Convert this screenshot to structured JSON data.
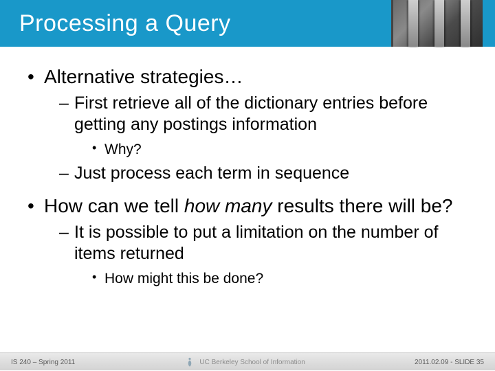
{
  "title": "Processing a Query",
  "bullets": {
    "b1": {
      "text": "Alternative strategies…",
      "sub": {
        "s1": {
          "text": "First retrieve all of the dictionary entries before getting any postings information",
          "sub": {
            "t1": "Why?"
          }
        },
        "s2": {
          "text": "Just process each term in sequence"
        }
      }
    },
    "b2": {
      "pre": "How can we tell ",
      "em": "how many",
      "post": " results there will be?",
      "sub": {
        "s1": {
          "text": "It is possible to put a limitation on the number of items returned",
          "sub": {
            "t1": "How might this be done?"
          }
        }
      }
    }
  },
  "footer": {
    "left": "IS 240 – Spring 2011",
    "center": "UC Berkeley School of Information",
    "right": "2011.02.09 - SLIDE 35"
  }
}
